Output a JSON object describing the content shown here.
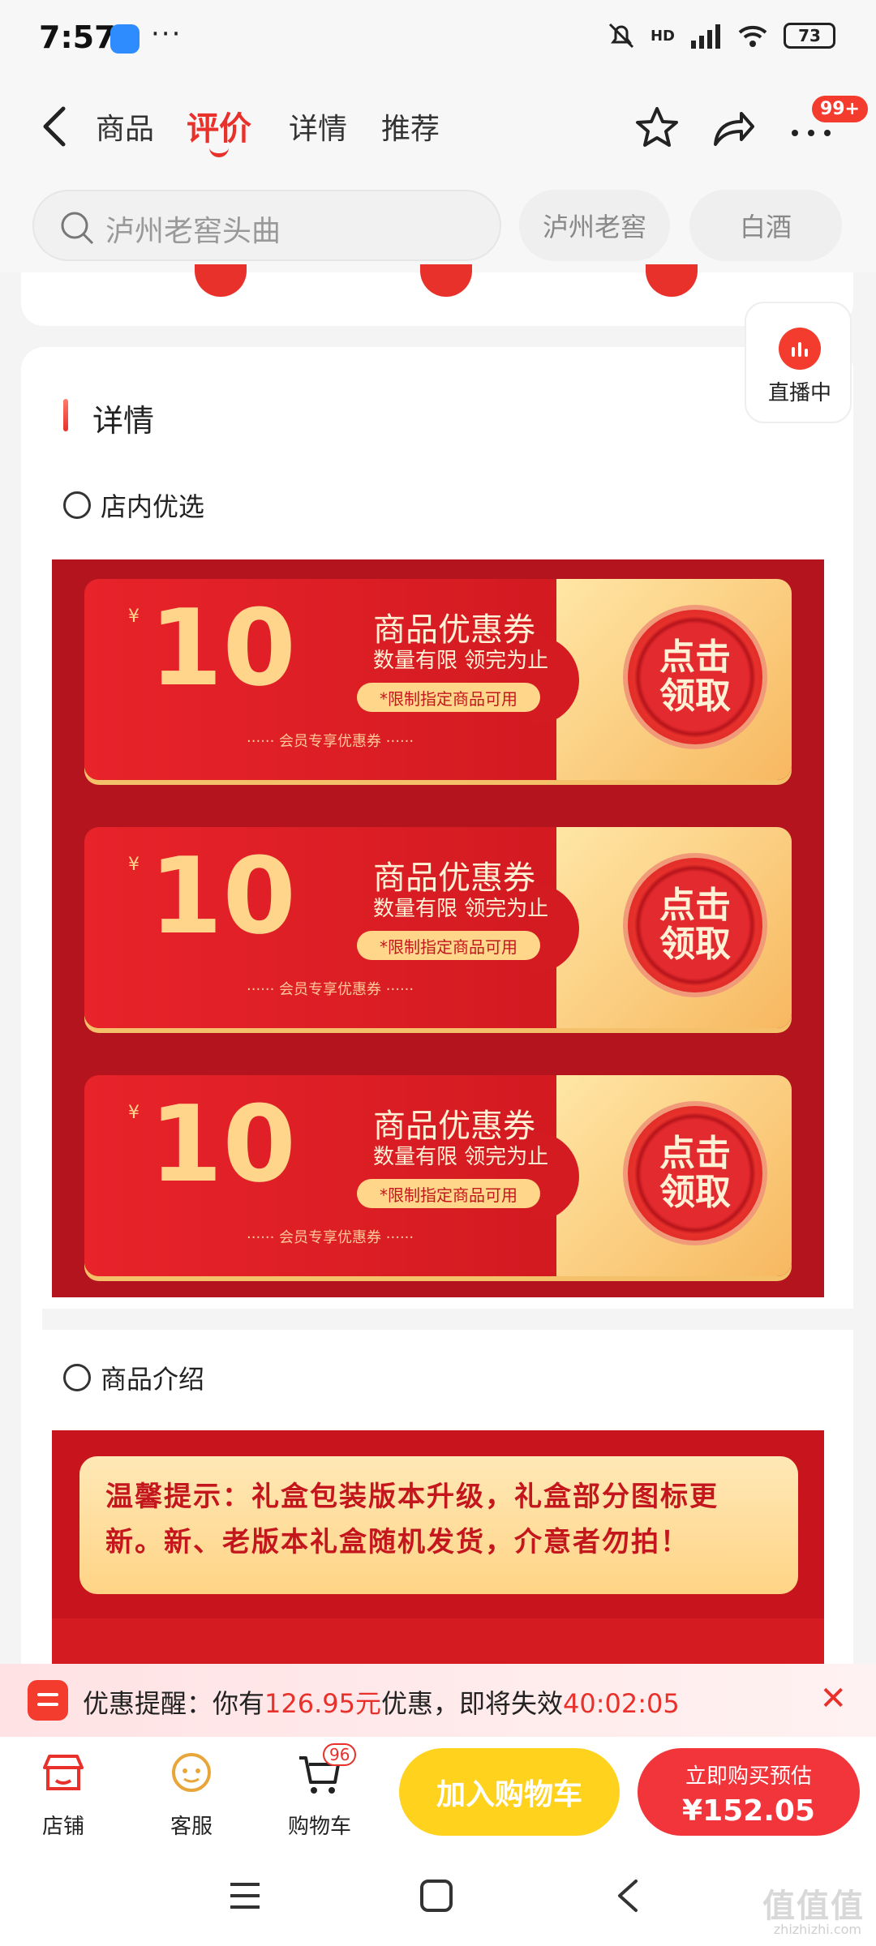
{
  "status_bar": {
    "time": "7:57",
    "more": "···",
    "network": "HD",
    "battery": "73"
  },
  "nav": {
    "tabs": [
      {
        "label": "商品"
      },
      {
        "label": "评价"
      },
      {
        "label": "详情"
      },
      {
        "label": "推荐"
      }
    ],
    "message_badge": "99+"
  },
  "search": {
    "placeholder": "泸州老窖头曲",
    "chips": [
      "泸州老窖",
      "白酒"
    ]
  },
  "live": {
    "label": "直播中"
  },
  "details": {
    "title": "详情",
    "shop_picks": "店内优选",
    "product_intro": "商品介绍",
    "coupons": [
      {
        "currency": "¥",
        "amount": "10",
        "title": "商品优惠券",
        "subtitle": "数量有限 领完为止",
        "limit": "*限制指定商品可用",
        "member": "······  会员专享优惠券  ······",
        "claim": "点击领取"
      },
      {
        "currency": "¥",
        "amount": "10",
        "title": "商品优惠券",
        "subtitle": "数量有限 领完为止",
        "limit": "*限制指定商品可用",
        "member": "······  会员专享优惠券  ······",
        "claim": "点击领取"
      },
      {
        "currency": "¥",
        "amount": "10",
        "title": "商品优惠券",
        "subtitle": "数量有限 领完为止",
        "limit": "*限制指定商品可用",
        "member": "······  会员专享优惠券  ······",
        "claim": "点击领取"
      }
    ],
    "intro_note": "温馨提示：礼盒包装版本升级，礼盒部分图标更新。新、老版本礼盒随机发货，介意者勿拍！"
  },
  "promo": {
    "prefix": "优惠提醒：你有",
    "amount": "126.95元",
    "middle": "优惠，即将失效",
    "countdown": "40:02:05",
    "close": "✕"
  },
  "bottom_bar": {
    "shop": "店铺",
    "service": "客服",
    "cart": "购物车",
    "cart_count": "96",
    "add_to_cart": "加入购物车",
    "buy_now": "立即购买预估",
    "buy_price": "¥152.05"
  },
  "watermark": {
    "text": "值值值",
    "sub": "zhizhizhi.com"
  },
  "colors": {
    "accent": "#e8312b",
    "cart_button": "#ffd21e",
    "buy_button": "#f2353a",
    "coupon_panel": "#b4141d"
  }
}
